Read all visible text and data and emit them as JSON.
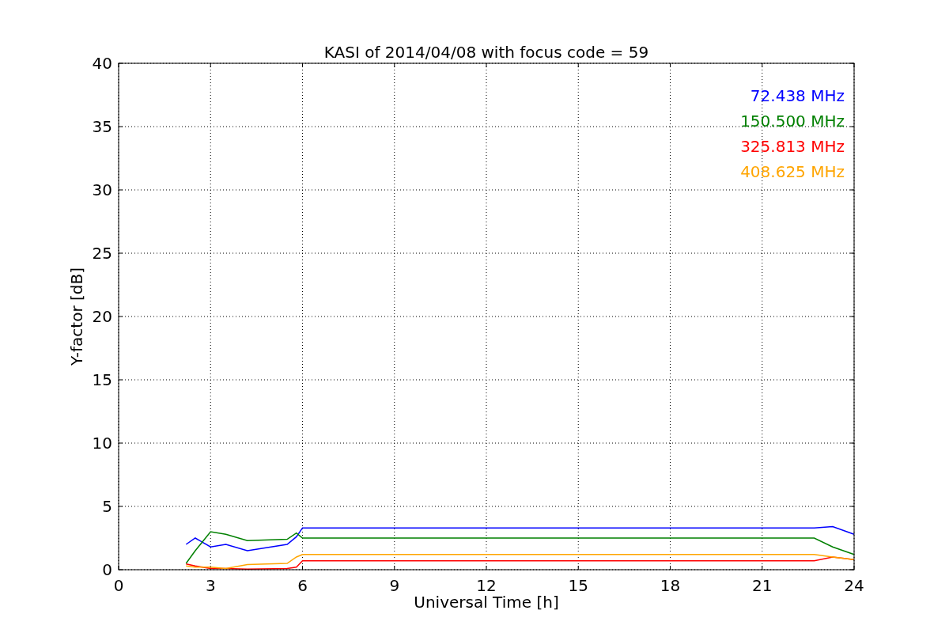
{
  "chart_data": {
    "type": "line",
    "title": "KASI of 2014/04/08 with focus code = 59",
    "xlabel": "Universal Time [h]",
    "ylabel": "Y-factor [dB]",
    "grid": true,
    "x": [
      2.2,
      2.5,
      3.0,
      3.5,
      4.2,
      5.5,
      5.8,
      6.0,
      22.7,
      23.3,
      24
    ],
    "series": [
      {
        "name": "72.438 MHz",
        "color": "#0000ff",
        "values": [
          2.0,
          2.5,
          1.8,
          2.0,
          1.5,
          2.0,
          2.6,
          3.3,
          3.3,
          3.4,
          2.8
        ]
      },
      {
        "name": "150.500 MHz",
        "color": "#008000",
        "values": [
          0.5,
          1.5,
          3.0,
          2.8,
          2.3,
          2.4,
          2.9,
          2.5,
          2.5,
          1.8,
          1.2
        ]
      },
      {
        "name": "325.813 MHz",
        "color": "#ff0000",
        "values": [
          0.45,
          0.3,
          0.1,
          0.1,
          0.05,
          0.1,
          0.2,
          0.7,
          0.7,
          1.0,
          0.8
        ]
      },
      {
        "name": "408.625 MHz",
        "color": "#ffa500",
        "values": [
          0.3,
          0.2,
          0.2,
          0.1,
          0.4,
          0.5,
          1.0,
          1.2,
          1.2,
          1.0,
          0.8
        ]
      }
    ],
    "xlim": [
      0,
      24
    ],
    "ylim": [
      0,
      40
    ],
    "xticks": [
      0,
      3,
      6,
      9,
      12,
      15,
      18,
      21,
      24
    ],
    "yticks": [
      0,
      5,
      10,
      15,
      20,
      25,
      30,
      35,
      40
    ]
  }
}
